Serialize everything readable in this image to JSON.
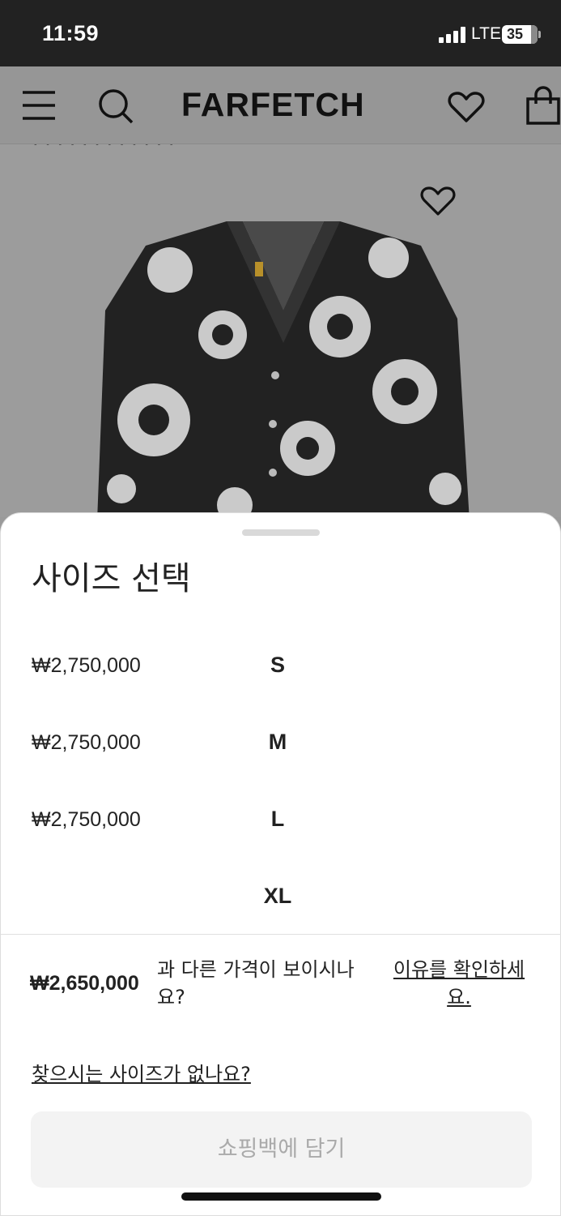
{
  "status_bar": {
    "time": "11:59",
    "network": "LTE",
    "battery": "35"
  },
  "header": {
    "logo": "FARFETCH"
  },
  "size_sheet": {
    "title": "사이즈 선택",
    "sizes": [
      {
        "price": "₩2,750,000",
        "label": "S"
      },
      {
        "price": "₩2,750,000",
        "label": "M"
      },
      {
        "price": "₩2,750,000",
        "label": "L"
      },
      {
        "price": "",
        "label": "XL"
      }
    ],
    "price_note": {
      "price": "₩2,650,000",
      "text": "과 다른 가격이 보이시나요?",
      "link": "이유를 확인하세요."
    },
    "size_help_link": "찾으시는 사이즈가 없나요?",
    "add_to_bag": "쇼핑백에 담기"
  }
}
